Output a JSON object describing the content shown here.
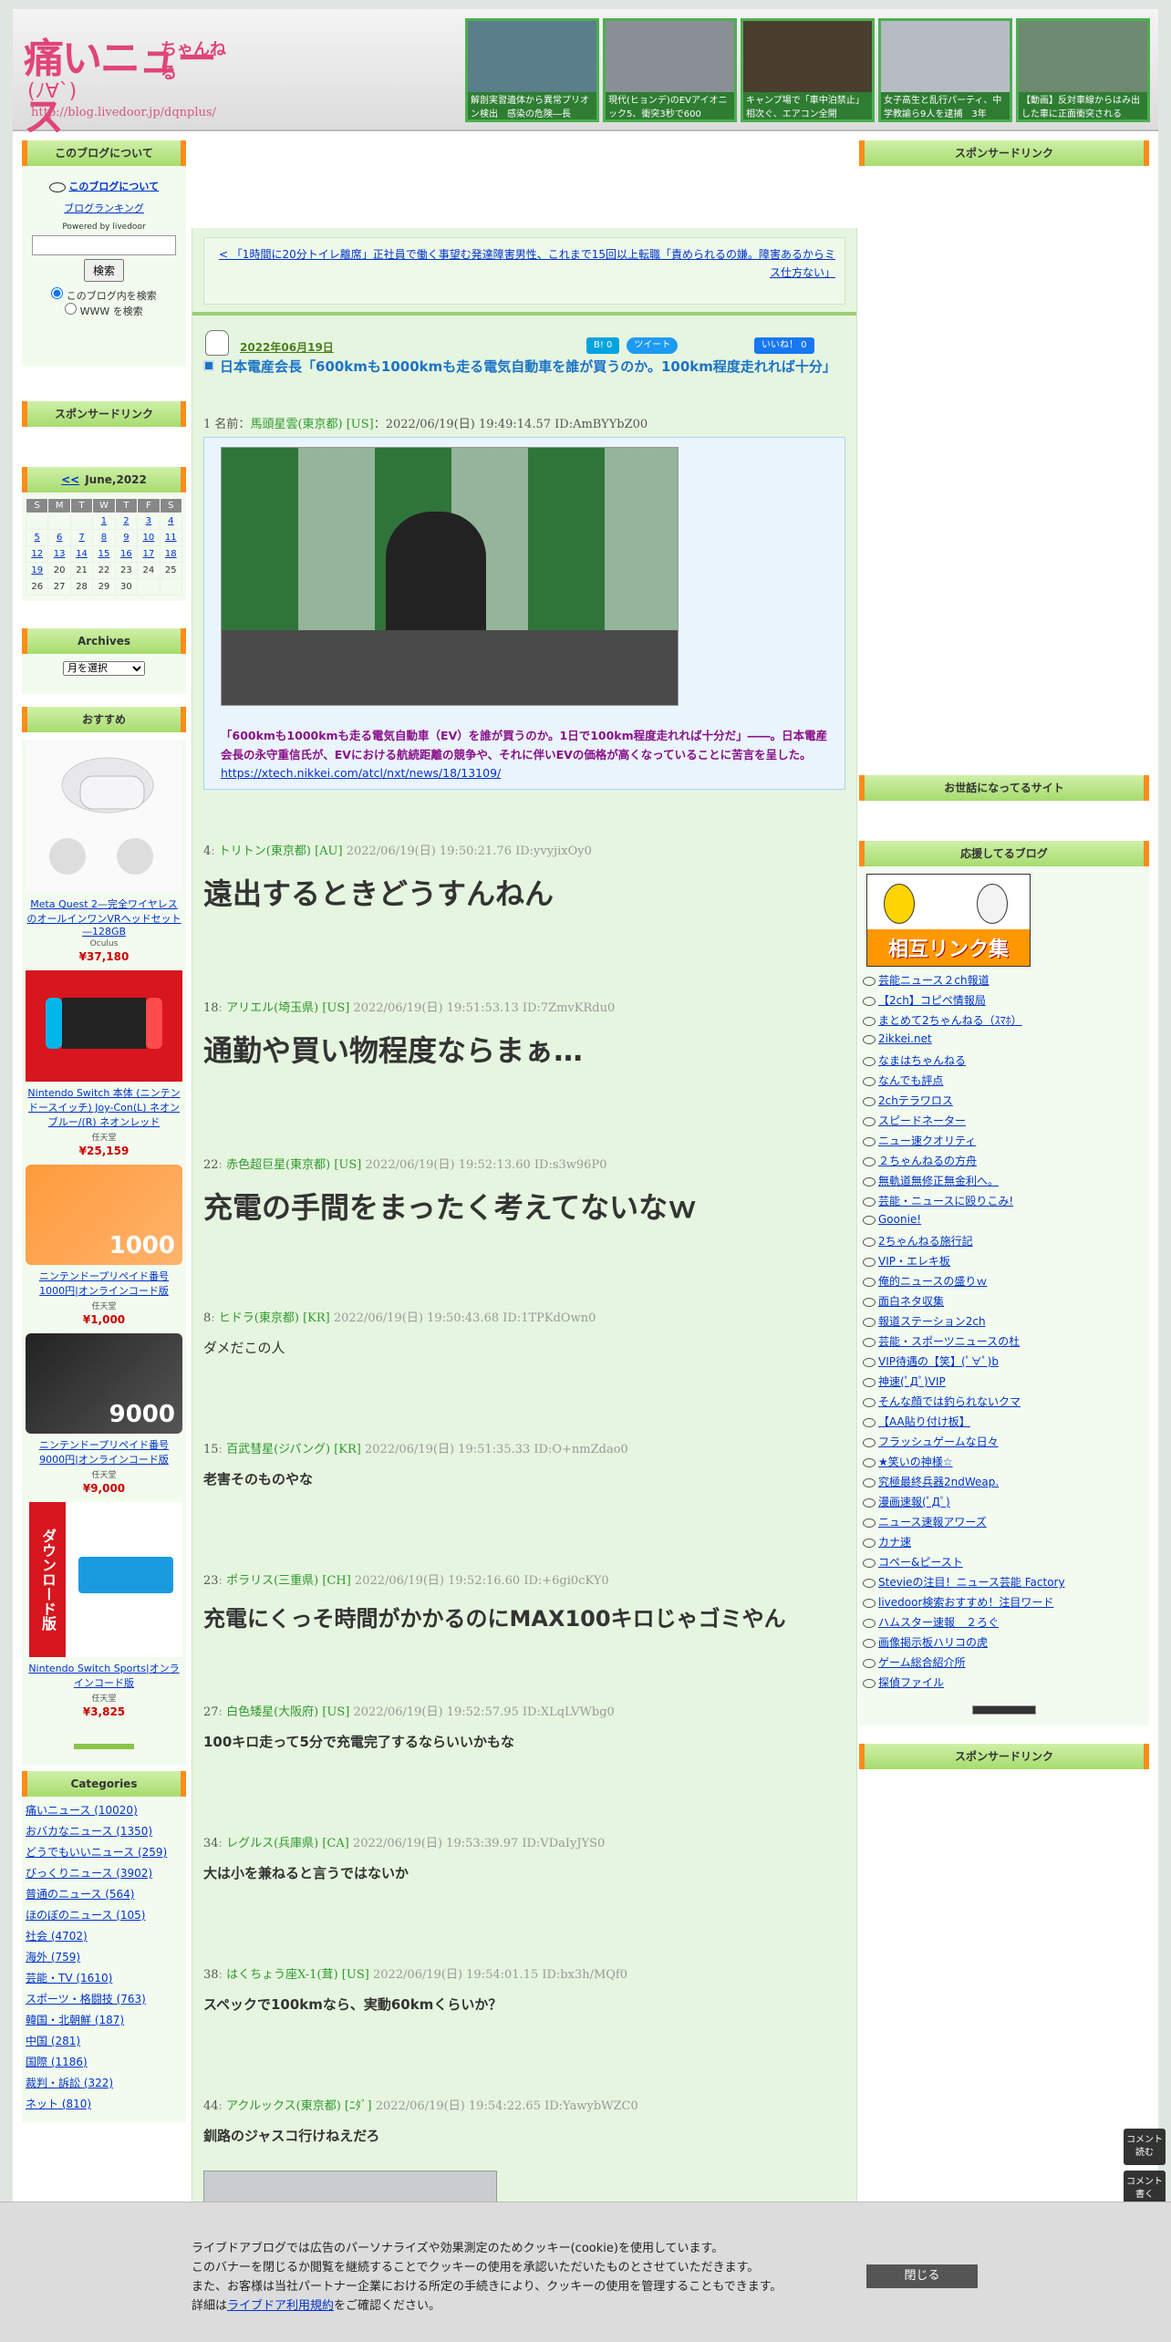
{
  "header": {
    "logo_main": "痛いニュース",
    "logo_sub": "ちゃんねる",
    "logo_face": "(ﾉ∀`)",
    "logo_url": "http://blog.livedoor.jp/dqnplus/",
    "thumbs": [
      {
        "caption": "解剖実習遺体から異常プリオン検出　感染の危険―長",
        "color": "#5a7e8a"
      },
      {
        "caption": "現代(ヒョンデ)のEVアイオニック5、衝突3秒で600",
        "color": "#8a8f96"
      },
      {
        "caption": "キャンプ場で「車中泊禁止」相次ぐ、エアコン全開",
        "color": "#4a3e2e"
      },
      {
        "caption": "女子高生と乱行パーティ、中学教諭ら9人を逮捕　3年",
        "color": "#b7bcc4"
      },
      {
        "caption": "【動画】反対車線からはみ出した車に正面衝突される",
        "color": "#6e8a70"
      }
    ]
  },
  "left": {
    "about_title": "このブログについて",
    "about_link": "このブログについて",
    "ranking_link": "ブログランキング",
    "powered": "Powered by livedoor",
    "search_button": "検索",
    "radio_blog": "このブログ内を検索",
    "radio_www": "WWW を検索",
    "sponsor_title": "スポンサードリンク",
    "calendar_prev": "<<",
    "calendar_title": "June,2022",
    "calendar_days": [
      "S",
      "M",
      "T",
      "W",
      "T",
      "F",
      "S"
    ],
    "calendar_rows": [
      [
        "",
        "",
        "",
        "1",
        "2",
        "3",
        "4"
      ],
      [
        "5",
        "6",
        "7",
        "8",
        "9",
        "10",
        "11"
      ],
      [
        "12",
        "13",
        "14",
        "15",
        "16",
        "17",
        "18"
      ],
      [
        "19",
        "20",
        "21",
        "22",
        "23",
        "24",
        "25"
      ],
      [
        "26",
        "27",
        "28",
        "29",
        "30",
        "",
        ""
      ]
    ],
    "archives_title": "Archives",
    "archives_select": "月を選択",
    "recommend_title": "おすすめ",
    "products": [
      {
        "name": "Meta Quest 2—完全ワイヤレスのオールインワンVRヘッドセット—128GB",
        "shop": "Oculus",
        "price": "¥37,180"
      },
      {
        "name": "Nintendo Switch 本体 (ニンテンドースイッチ) Joy-Con(L) ネオンブルー/(R) ネオンレッド",
        "shop": "任天堂",
        "price": "¥25,159"
      },
      {
        "name": "ニンテンドープリペイド番号 1000円|オンラインコード版",
        "shop": "任天堂",
        "price": "¥1,000",
        "label": "1000"
      },
      {
        "name": "ニンテンドープリペイド番号 9000円|オンラインコード版",
        "shop": "任天堂",
        "price": "¥9,000",
        "label": "9000"
      },
      {
        "name": "Nintendo Switch Sports|オンラインコード版",
        "shop": "任天堂",
        "price": "¥3,825",
        "label": "ダウンロード版"
      }
    ],
    "categories_title": "Categories",
    "categories": [
      "痛いニュース (10020)",
      "おバカなニュース (1350)",
      "どうでもいいニュース (259)",
      "びっくりニュース (3902)",
      "普通のニュース (564)",
      "ほのぼのニュース (105)",
      "社会 (4702)",
      "海外 (759)",
      "芸能・TV (1610)",
      "スポーツ・格闘技 (763)",
      "韓国・北朝鮮 (187)",
      "中国 (281)",
      "国際 (1186)",
      "裁判・訴訟 (322)",
      "ネット (810)"
    ]
  },
  "main": {
    "pager": "< 「1時間に20分トイレ離席」正社員で働く事望む発達障害男性、これまで15回以上転職「責められるの嫌。障害あるからミス仕方ない」",
    "date": "2022年06月19日",
    "hatena": "B! 0",
    "tweet": "ツイート",
    "like": "いいね！ 0",
    "title": "日本電産会長「600kmも1000kmも走る電気自動車を誰が買うのか。100km程度走れれば十分」",
    "first": {
      "no": "1",
      "label": "名前：",
      "name": "馬頭星雲(東京都) [US]",
      "meta": "：2022/06/19(日) 19:49:14.57 ID:AmBYYbZ00",
      "quote_text": "「600kmも1000kmも走る電気自動車（EV）を誰が買うのか。1日で100km程度走れれば十分だ」――。日本電産会長の永守重信氏が、EVにおける航続距離の競争や、それに伴いEVの価格が高くなっていることに苦言を呈した。",
      "quote_link": "https://xtech.nikkei.com/atcl/nxt/news/18/13109/"
    },
    "responses": [
      {
        "no": "4",
        "name": "トリトン(東京都) [AU]",
        "meta": "2022/06/19(日) 19:50:21.76 ID:yvyjixOy0",
        "body": "遠出するときどうすんねん",
        "size": "big"
      },
      {
        "no": "18",
        "name": "アリエル(埼玉県) [US]",
        "meta": "2022/06/19(日) 19:51:53.13 ID:7ZmvKRdu0",
        "body": "通勤や買い物程度ならまぁ…",
        "size": "big"
      },
      {
        "no": "22",
        "name": "赤色超巨星(東京都) [US]",
        "meta": "2022/06/19(日) 19:52:13.60 ID:s3w96P0",
        "body": "充電の手間をまったく考えてないなｗ",
        "size": "big"
      },
      {
        "no": "8",
        "name": "ヒドラ(東京都) [KR]",
        "meta": "2022/06/19(日) 19:50:43.68 ID:1TPKdOwn0",
        "body": "ダメだこの人",
        "size": "sm"
      },
      {
        "no": "15",
        "name": "百武彗星(ジパング) [KR]",
        "meta": "2022/06/19(日) 19:51:35.33 ID:O+nmZdao0",
        "body": "老害そのものやな",
        "size": "sm"
      },
      {
        "no": "23",
        "name": "ポラリス(三重県) [CH]",
        "meta": "2022/06/19(日) 19:52:16.60 ID:+6gi0cKY0",
        "body": "充電にくっそ時間がかかるのにMAX100キロじゃゴミやん",
        "size": "mid"
      },
      {
        "no": "27",
        "name": "白色矮星(大阪府) [US]",
        "meta": "2022/06/19(日) 19:52:57.95 ID:XLqLVWbg0",
        "body": "100キロ走って5分で充電完了するならいいかもな",
        "size": "sm"
      },
      {
        "no": "34",
        "name": "レグルス(兵庫県) [CA]",
        "meta": "2022/06/19(日) 19:53:39.97 ID:VDaIyJYS0",
        "body": "大は小を兼ねると言うではないか",
        "size": "sm"
      },
      {
        "no": "38",
        "name": "はくちょう座X-1(茸) [US]",
        "meta": "2022/06/19(日) 19:54:01.15 ID:bx3h/MQf0",
        "body": "スペックで100kmなら、実動60kmくらいか？",
        "size": "sm"
      },
      {
        "no": "44",
        "name": "アクルックス(東京都) [ﾆﾀﾞ]",
        "meta": "2022/06/19(日) 19:54:22.65 ID:YawybWZC0",
        "body": "釧路のジャスコ行けねえだろ",
        "size": "sm"
      }
    ]
  },
  "right": {
    "sponsor_title": "スポンサードリンク",
    "friends_title": "お世話になってるサイト",
    "support_title": "応援してるブログ",
    "banner_text": "相互リンク集",
    "blogs": [
      "芸能ニュース２ch報道",
      "【2ch】コピペ情報局",
      "まとめて2ちゃんねる（ｽﾏﾎ）",
      "2ikkei.net",
      "なまはちゃんねる",
      "なんでも評点",
      "2chテラワロス",
      "スピードネーター",
      "ニュー速クオリティ",
      "２ちゃんねるの方舟",
      "無軌道無修正無金利へ。",
      "芸能・ニュースに殴りこみ!",
      "Goonie!",
      "2ちゃんねる施行記",
      "VIP・エレキ板",
      "俺的ニュースの盛りｗ",
      "面白ネタ収集",
      "報道ステーション2ch",
      "芸能・スポーツニュースの杜",
      "VIP待遇の【笑】(ﾟ∀ﾟ)b",
      "神速(ﾟДﾟ)VIP",
      "そんな顔では釣られないクマ",
      "【AA貼り付け板】",
      "フラッシュゲームな日々",
      "★笑いの神様☆",
      "究極最終兵器2ndWeap.",
      "漫画速報(ﾟДﾟ)",
      "ニュース速報アワーズ",
      "カナ速",
      "コペー&ピースト",
      "Stevieの注目！ニュース芸能 Factory",
      "livedoor検索おすすめ！注目ワード",
      "ハムスター速報　２ろぐ",
      "画像掲示板ハリコの虎",
      "ゲーム総合紹介所",
      "探偵ファイル"
    ],
    "sponsor_title2": "スポンサードリンク"
  },
  "cookie": {
    "line1": "ライブドアブログでは広告のパーソナライズや効果測定のためクッキー(cookie)を使用しています。",
    "line2": "このバナーを閉じるか閲覧を継続することでクッキーの使用を承認いただいたものとさせていただきます。",
    "line3": "また、お客様は当社パートナー企業における所定の手続きにより、クッキーの使用を管理することもできます。",
    "line4_pre": "詳細は",
    "line4_link": "ライブドア利用規約",
    "line4_post": "をご確認ください。",
    "close": "閉じる"
  },
  "float": {
    "read": "コメント読む",
    "write": "コメント書く"
  }
}
